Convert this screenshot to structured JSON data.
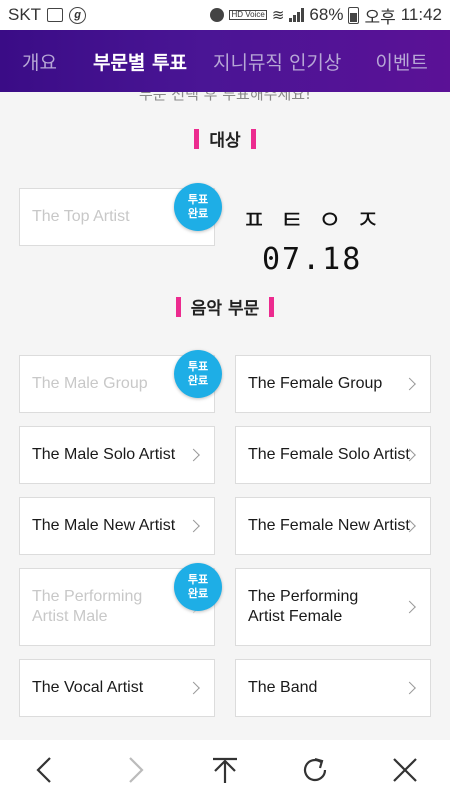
{
  "status_bar": {
    "carrier": "SKT",
    "battery": "68%",
    "ampm": "오후",
    "time": "11:42",
    "hd_label": "HD Voice"
  },
  "tabs": [
    {
      "label": "개요"
    },
    {
      "label": "부문별 투표"
    },
    {
      "label": "지니뮤직 인기상"
    },
    {
      "label": "이벤트"
    }
  ],
  "intro_text": "부문 선택 후 투표해주세요!",
  "sections": {
    "grand": {
      "title": "대상"
    },
    "music": {
      "title": "음악 부문"
    }
  },
  "badge": {
    "line1": "투표",
    "line2": "완료"
  },
  "handwritten": {
    "line1": "ㅍㅌㅇㅈ",
    "line2": "07.18"
  },
  "categories": {
    "top_artist": "The Top Artist",
    "male_group": "The Male Group",
    "female_group": "The Female Group",
    "male_solo": "The Male Solo Artist",
    "female_solo": "The Female Solo Artist",
    "male_new": "The Male New Artist",
    "female_new": "The Female New Artist",
    "performing_male_1": "The Performing",
    "performing_male_2": "Artist Male",
    "performing_female_1": "The Performing",
    "performing_female_2": "Artist Female",
    "vocal": "The Vocal Artist",
    "band": "The Band"
  },
  "colors": {
    "tab_gradient_start": "#3a0c86",
    "tab_gradient_end": "#5b1196",
    "accent_pink": "#ec2b8f",
    "badge_blue": "#1eaee6"
  }
}
